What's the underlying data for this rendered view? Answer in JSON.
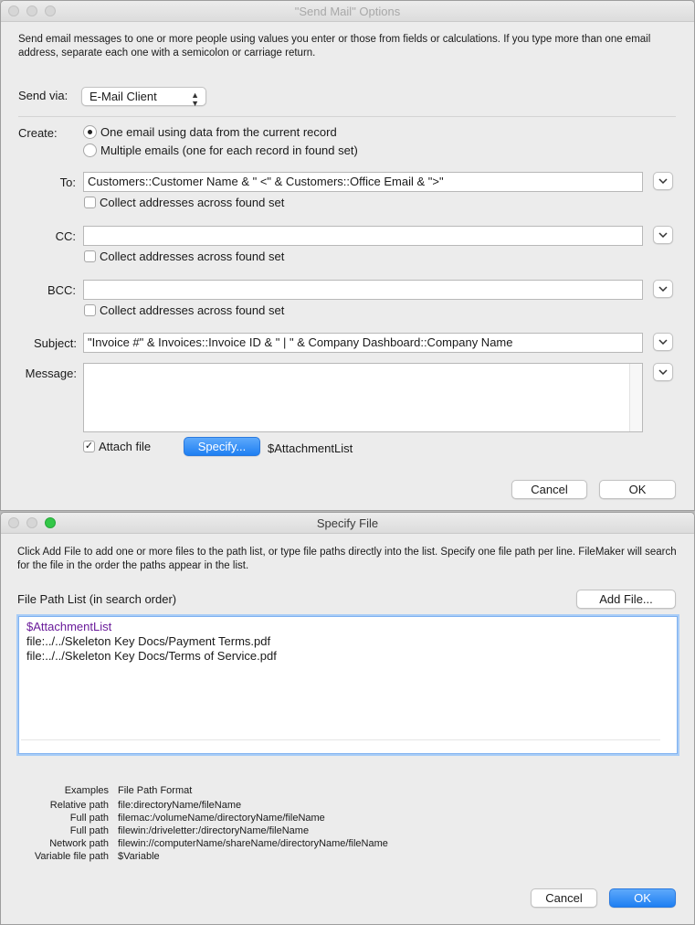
{
  "send_mail": {
    "title": "\"Send Mail\" Options",
    "description": "Send email messages to one or more people using values you enter or those from fields or calculations. If you type more than one email address, separate each one with a semicolon or carriage return.",
    "send_via_label": "Send via:",
    "send_via_value": "E-Mail Client",
    "create_label": "Create:",
    "create_options": [
      "One email using data from the current record",
      "Multiple emails (one for each record in found set)"
    ],
    "create_selected": 0,
    "to_label": "To:",
    "to_value": "Customers::Customer Name & \" <\" & Customers::Office Email & \">\"",
    "cc_label": "CC:",
    "cc_value": "",
    "bcc_label": "BCC:",
    "bcc_value": "",
    "collect_label": "Collect addresses across found set",
    "subject_label": "Subject:",
    "subject_value": "\"Invoice #\" & Invoices::Invoice ID & \" | \" & Company Dashboard::Company Name",
    "message_label": "Message:",
    "message_value": "",
    "attach_label": "Attach file",
    "attach_checked": true,
    "specify_label": "Specify...",
    "attachment_value": "$AttachmentList",
    "cancel_label": "Cancel",
    "ok_label": "OK"
  },
  "specify_file": {
    "title": "Specify File",
    "description": "Click Add File to add one or more files to the path list, or type file paths directly into the list. Specify one file path per line. FileMaker will search for the file in the order the paths appear in the list.",
    "list_label": "File Path List (in search order)",
    "add_file_label": "Add File...",
    "paths": [
      "$AttachmentList",
      "file:../../Skeleton Key Docs/Payment Terms.pdf",
      "file:../../Skeleton Key Docs/Terms of Service.pdf"
    ],
    "examples_header": [
      "Examples",
      "File Path Format"
    ],
    "examples": [
      [
        "Relative path",
        "file:directoryName/fileName"
      ],
      [
        "Full path",
        "filemac:/volumeName/directoryName/fileName"
      ],
      [
        "Full path",
        "filewin:/driveletter:/directoryName/fileName"
      ],
      [
        "Network path",
        "filewin://computerName/shareName/directoryName/fileName"
      ],
      [
        "Variable file path",
        "$Variable"
      ]
    ],
    "cancel_label": "Cancel",
    "ok_label": "OK"
  },
  "colors": {
    "variable_text": "#6a1b9a",
    "accent_blue": "#1e7ff2"
  }
}
